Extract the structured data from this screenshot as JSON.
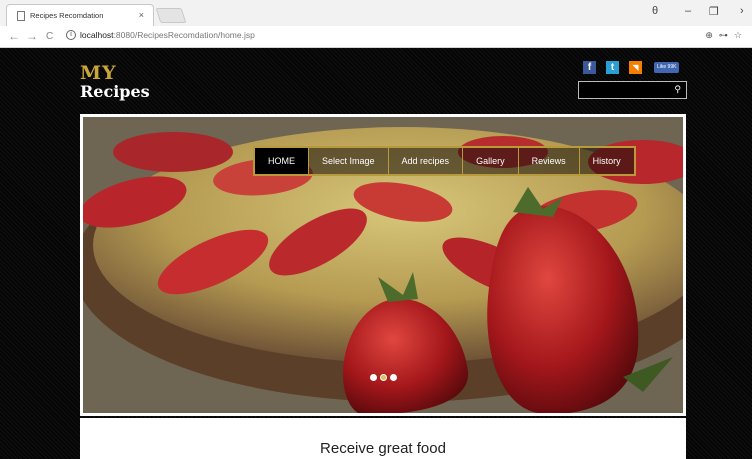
{
  "browser": {
    "tab_title": "Recipes Recomdation",
    "tab_close": "×",
    "url_host": "localhost",
    "url_path": ":8080/RecipesRecomdation/home.jsp",
    "back": "←",
    "forward": "→",
    "reload": "C",
    "info": "i",
    "account_icon": "θ",
    "minimize": "–",
    "restore": "❐",
    "close_win": "›",
    "zoom_icon": "⊕",
    "key_icon": "⊶",
    "star_icon": "☆"
  },
  "site": {
    "logo_line1": "MY",
    "logo_line2": "Recipes"
  },
  "social": {
    "facebook": "f",
    "twitter": "t",
    "rss": "◥",
    "like": "Like 99K"
  },
  "search": {
    "placeholder": "",
    "icon": "⚲"
  },
  "nav": {
    "items": [
      "HOME",
      "Select Image",
      "Add recipes",
      "Gallery",
      "Reviews",
      "History"
    ],
    "active_index": 0
  },
  "slider": {
    "dot_count": 3,
    "active_dot": 1
  },
  "content": {
    "title": "Receive great food"
  },
  "colors": {
    "accent": "#b89a3a",
    "logo_gold": "#c9a63a"
  }
}
